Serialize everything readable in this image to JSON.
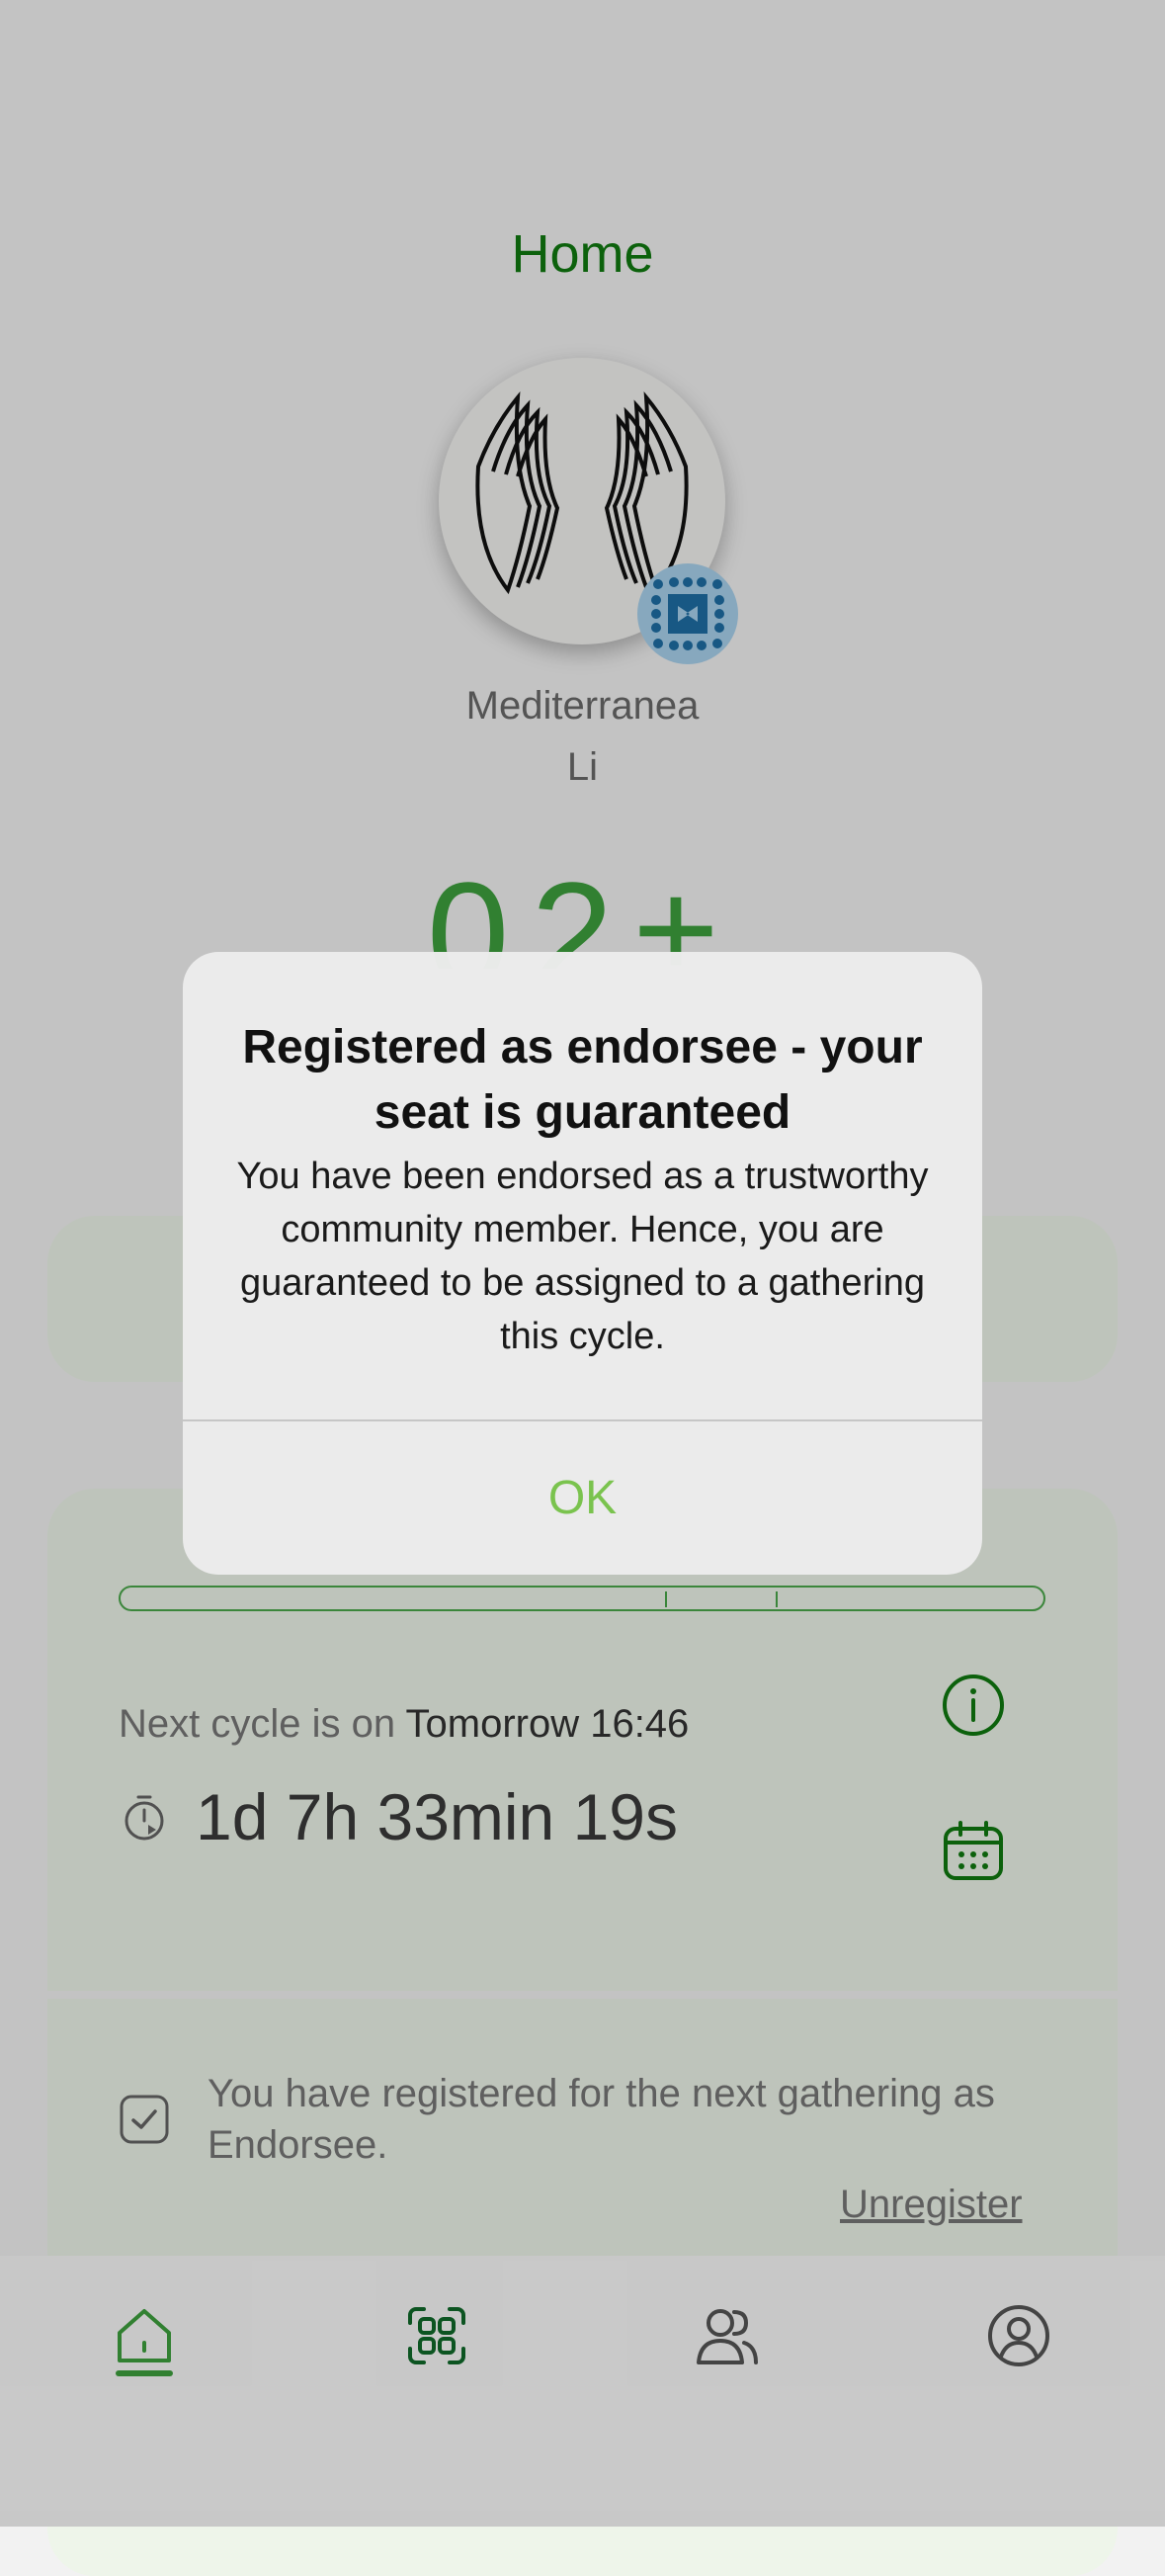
{
  "header": {
    "title": "Home"
  },
  "profile": {
    "first_name": "Mediterranea",
    "last_name": "Li"
  },
  "score": {
    "display": "02±"
  },
  "cycle": {
    "next_label": "Next cycle is on",
    "next_value": "Tomorrow 16:46",
    "countdown": "1d 7h 33min 19s",
    "progress_ticks": [
      0.59,
      0.71
    ]
  },
  "registration": {
    "message": "You have registered for the next gathering as Endorsee.",
    "unregister_label": "Unregister"
  },
  "dialog": {
    "title": "Registered as endorsee - your seat is guaranteed",
    "message": "You have been endorsed as a trustworthy community member. Hence, you are guaranteed to be assigned to a gathering this cycle.",
    "ok_label": "OK"
  },
  "tabs": [
    {
      "name": "home",
      "icon": "home-icon",
      "active": true
    },
    {
      "name": "apps",
      "icon": "grid-icon",
      "active": false
    },
    {
      "name": "people",
      "icon": "people-icon",
      "active": false
    },
    {
      "name": "profile",
      "icon": "user-icon",
      "active": false
    }
  ],
  "colors": {
    "accent": "#0f7a0f",
    "accent_light": "#3ea03e",
    "ok": "#7ac34e",
    "badge": "#1f7bb5"
  }
}
